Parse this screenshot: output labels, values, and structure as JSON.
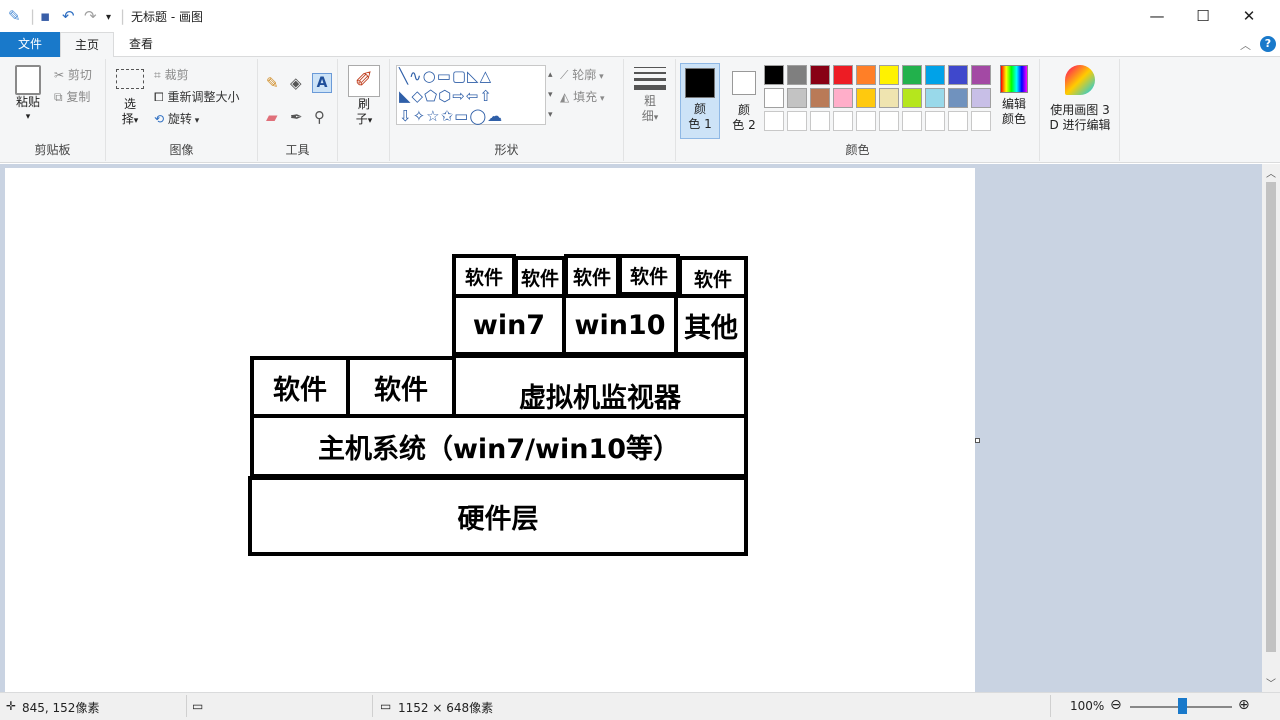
{
  "window": {
    "title": "无标题 - 画图",
    "minimize_icon": "minimize-icon",
    "maximize_icon": "maximize-icon",
    "close_icon": "close-icon"
  },
  "tabs": [
    {
      "label": "文件"
    },
    {
      "label": "主页"
    },
    {
      "label": "查看"
    }
  ],
  "ribbon": {
    "clipboard": {
      "label": "剪贴板",
      "paste": "粘贴",
      "cut": "剪切",
      "copy": "复制"
    },
    "image": {
      "label": "图像",
      "select": "选",
      "select2": "择",
      "crop": "裁剪",
      "resize": "重新调整大小",
      "rotate": "旋转"
    },
    "tools": {
      "label": "工具",
      "text_tool": "A"
    },
    "brushes": {
      "label": "刷",
      "label2": "子"
    },
    "shapes": {
      "label": "形状",
      "outline": "轮廓",
      "fill": "填充"
    },
    "size": {
      "label": "粗",
      "label2": "细"
    },
    "colors": {
      "label": "颜色",
      "color1": "颜",
      "color1b": "色 1",
      "color2": "颜",
      "color2b": "色 2",
      "edit": "编辑",
      "edit2": "颜色",
      "palette_row1": [
        "#000000",
        "#7f7f7f",
        "#880015",
        "#ed1c24",
        "#ff7f27",
        "#fff200",
        "#22b14c",
        "#00a2e8",
        "#3f48cc",
        "#a349a4"
      ],
      "palette_row2": [
        "#ffffff",
        "#c3c3c3",
        "#b97a57",
        "#ffaec9",
        "#ffc90e",
        "#efe4b0",
        "#b5e61d",
        "#99d9ea",
        "#7092be",
        "#c8bfe7"
      ]
    },
    "paint3d": {
      "label": "使用画图 3",
      "label2": "D 进行编辑"
    }
  },
  "diagram": {
    "row_top": [
      "软件",
      "软件",
      "软件",
      "软件",
      "软件"
    ],
    "row_os": [
      "win7",
      "win10",
      "其他"
    ],
    "row_left_soft": [
      "软件",
      "软件"
    ],
    "hypervisor": "虚拟机监视器",
    "host": "主机系统（win7/win10等）",
    "hardware": "硬件层"
  },
  "status": {
    "cursor_pos": "845, 152像素",
    "canvas_size": "1152 × 648像素",
    "zoom": "100%"
  }
}
